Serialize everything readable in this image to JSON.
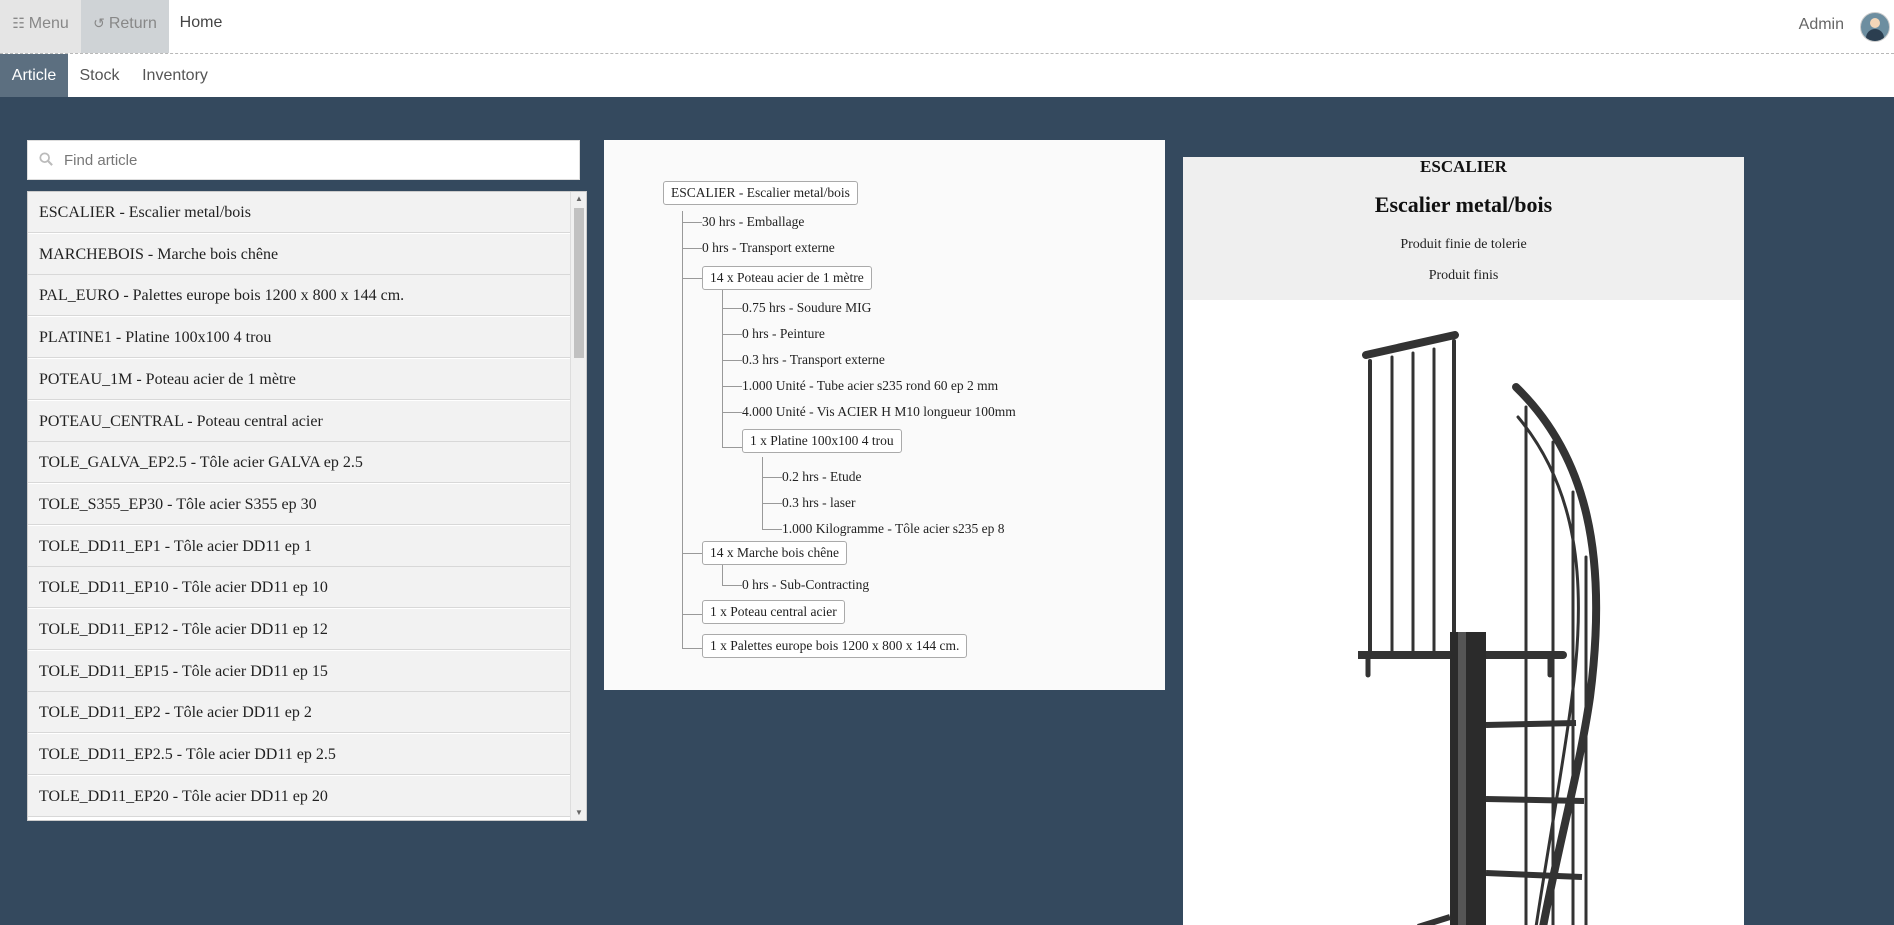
{
  "topbar": {
    "menu_label": "Menu",
    "return_label": "Return",
    "home_label": "Home",
    "user_label": "Admin"
  },
  "tabs": [
    "Article",
    "Stock",
    "Inventory"
  ],
  "search": {
    "placeholder": "Find article"
  },
  "articles": [
    "ESCALIER - Escalier metal/bois",
    "MARCHEBOIS - Marche bois chêne",
    "PAL_EURO - Palettes europe bois 1200 x 800 x 144 cm.",
    "PLATINE1 - Platine 100x100 4 trou",
    "POTEAU_1M - Poteau acier de 1 mètre",
    "POTEAU_CENTRAL - Poteau central acier",
    "TOLE_GALVA_EP2.5 - Tôle acier GALVA ep 2.5",
    "TOLE_S355_EP30 - Tôle acier S355 ep 30",
    "TOLE_DD11_EP1 - Tôle acier DD11 ep 1",
    "TOLE_DD11_EP10 - Tôle acier DD11 ep 10",
    "TOLE_DD11_EP12 - Tôle acier DD11 ep 12",
    "TOLE_DD11_EP15 - Tôle acier DD11 ep 15",
    "TOLE_DD11_EP2 - Tôle acier DD11 ep 2",
    "TOLE_DD11_EP2.5 - Tôle acier DD11 ep 2.5",
    "TOLE_DD11_EP20 - Tôle acier DD11 ep 20"
  ],
  "tree": {
    "root": "ESCALIER - Escalier metal/bois",
    "n1": "30 hrs - Emballage",
    "n2": "0 hrs - Transport externe",
    "n3": "14 x Poteau acier de 1 mètre",
    "n3a": "0.75 hrs - Soudure MIG",
    "n3b": "0 hrs - Peinture",
    "n3c": "0.3 hrs - Transport externe",
    "n3d": "1.000 Unité - Tube acier s235 rond 60 ep 2 mm",
    "n3e": "4.000 Unité - Vis ACIER H M10 longueur 100mm",
    "n3f": "1 x Platine 100x100 4 trou",
    "n3f1": "0.2 hrs - Etude",
    "n3f2": "0.3 hrs - laser",
    "n3f3": "1.000 Kilogramme - Tôle acier s235 ep 8",
    "n4": "14 x Marche bois chêne",
    "n4a": "0 hrs - Sub-Contracting",
    "n5": "1 x Poteau central acier",
    "n6": "1 x Palettes europe bois 1200 x 800 x 144 cm."
  },
  "detail": {
    "code": "ESCALIER",
    "name": "Escalier metal/bois",
    "description": "Produit finie de tolerie",
    "category": "Produit finis"
  }
}
